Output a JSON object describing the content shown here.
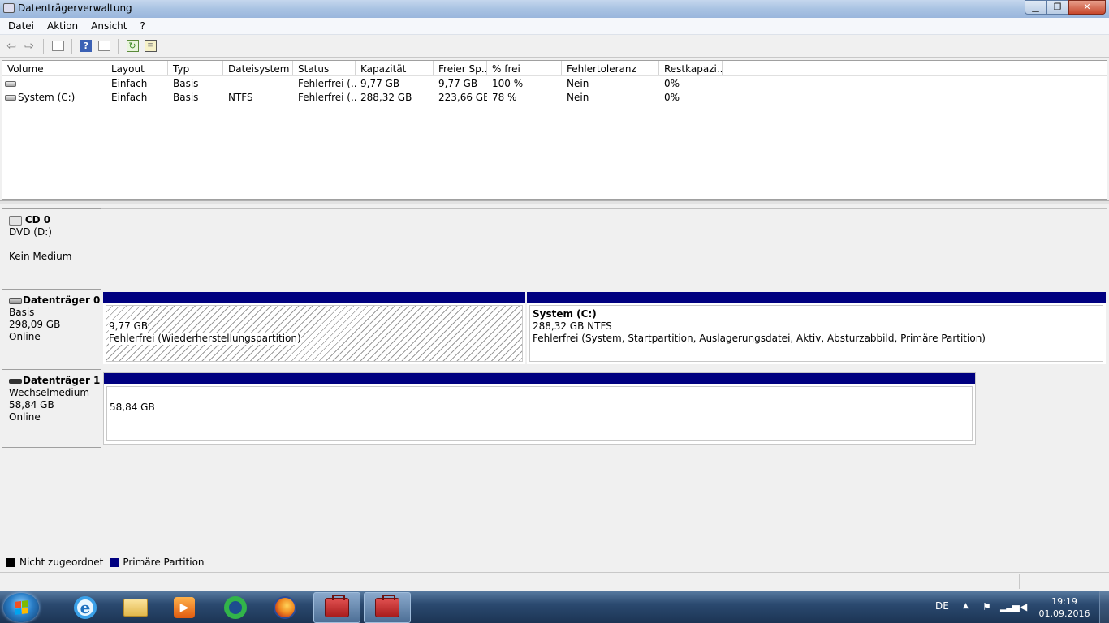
{
  "window": {
    "title": "Datenträgerverwaltung",
    "minimize": "▁",
    "maximize": "❐",
    "close": "✕"
  },
  "menu": [
    "Datei",
    "Aktion",
    "Ansicht",
    "?"
  ],
  "toolbar": {
    "icons": [
      "back-arrow-icon",
      "forward-arrow-icon",
      "console-tree-icon",
      "help-icon",
      "properties-icon",
      "refresh-icon",
      "list-icon"
    ],
    "help_glyph": "?"
  },
  "volume_list": {
    "columns": [
      "Volume",
      "Layout",
      "Typ",
      "Dateisystem",
      "Status",
      "Kapazität",
      "Freier Sp...",
      "% frei",
      "Fehlertoleranz",
      "Restkapazi..."
    ],
    "rows": [
      [
        "",
        "Einfach",
        "Basis",
        "",
        "Fehlerfrei (...",
        "9,77 GB",
        "9,77 GB",
        "100 %",
        "Nein",
        "0%"
      ],
      [
        "System (C:)",
        "Einfach",
        "Basis",
        "NTFS",
        "Fehlerfrei (...",
        "288,32 GB",
        "223,66 GB",
        "78 %",
        "Nein",
        "0%"
      ]
    ]
  },
  "disks": {
    "cd0": {
      "name": "CD 0",
      "line1": "DVD (D:)",
      "line2": "",
      "line3": "Kein Medium"
    },
    "disk0": {
      "name": "Datenträger 0",
      "line1": "Basis",
      "line2": "298,09 GB",
      "line3": "Online",
      "partitions": [
        {
          "title": "",
          "size": "9,77 GB",
          "status": "Fehlerfrei (Wiederherstellungspartition)"
        },
        {
          "title": "System  (C:)",
          "size": "288,32 GB NTFS",
          "status": "Fehlerfrei (System, Startpartition, Auslagerungsdatei, Aktiv, Absturzabbild, Primäre Partition)"
        }
      ]
    },
    "disk1": {
      "name": "Datenträger 1",
      "line1": "Wechselmedium",
      "line2": "58,84 GB",
      "line3": "Online",
      "partitions": [
        {
          "size": "58,84 GB"
        }
      ]
    }
  },
  "legend": [
    {
      "label": "Nicht zugeordnet",
      "color": "#000000"
    },
    {
      "label": "Primäre Partition",
      "color": "#000080"
    }
  ],
  "taskbar": {
    "apps": [
      "internet-explorer-icon",
      "explorer-folder-icon",
      "media-player-icon",
      "green-ring-app-icon",
      "firefox-icon",
      "computer-management-icon",
      "computer-management-icon-2"
    ],
    "ie_glyph": "e",
    "media_glyph": "▶",
    "tray": {
      "language": "DE",
      "arrow": "▲",
      "time": "19:19",
      "date": "01.09.2016"
    }
  }
}
